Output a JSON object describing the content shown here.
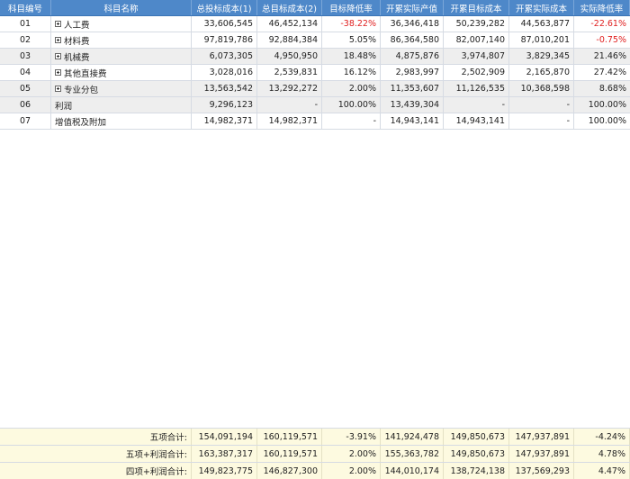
{
  "headers": [
    "科目编号",
    "科目名称",
    "总投标成本(1)",
    "总目标成本(2)",
    "目标降低率",
    "开累实际产值",
    "开累目标成本",
    "开累实际成本",
    "实际降低率"
  ],
  "rows": [
    {
      "code": "01",
      "name": "人工费",
      "expand": true,
      "v1": "33,606,545",
      "v2": "46,452,134",
      "r1": "-38.22%",
      "p": "36,346,418",
      "t": "50,239,282",
      "a": "44,563,877",
      "r2": "-22.61%",
      "r1neg": true,
      "r2neg": true,
      "alt": false
    },
    {
      "code": "02",
      "name": "材料费",
      "expand": true,
      "v1": "97,819,786",
      "v2": "92,884,384",
      "r1": "5.05%",
      "p": "86,364,580",
      "t": "82,007,140",
      "a": "87,010,201",
      "r2": "-0.75%",
      "r1neg": false,
      "r2neg": true,
      "alt": false
    },
    {
      "code": "03",
      "name": "机械费",
      "expand": true,
      "v1": "6,073,305",
      "v2": "4,950,950",
      "r1": "18.48%",
      "p": "4,875,876",
      "t": "3,974,807",
      "a": "3,829,345",
      "r2": "21.46%",
      "r1neg": false,
      "r2neg": false,
      "alt": true
    },
    {
      "code": "04",
      "name": "其他直接费",
      "expand": true,
      "v1": "3,028,016",
      "v2": "2,539,831",
      "r1": "16.12%",
      "p": "2,983,997",
      "t": "2,502,909",
      "a": "2,165,870",
      "r2": "27.42%",
      "r1neg": false,
      "r2neg": false,
      "alt": false
    },
    {
      "code": "05",
      "name": "专业分包",
      "expand": true,
      "v1": "13,563,542",
      "v2": "13,292,272",
      "r1": "2.00%",
      "p": "11,353,607",
      "t": "11,126,535",
      "a": "10,368,598",
      "r2": "8.68%",
      "r1neg": false,
      "r2neg": false,
      "alt": true
    },
    {
      "code": "06",
      "name": "利润",
      "expand": false,
      "v1": "9,296,123",
      "v2": "-",
      "r1": "100.00%",
      "p": "13,439,304",
      "t": "-",
      "a": "-",
      "r2": "100.00%",
      "r1neg": false,
      "r2neg": false,
      "alt": true
    },
    {
      "code": "07",
      "name": "增值税及附加",
      "expand": false,
      "v1": "14,982,371",
      "v2": "14,982,371",
      "r1": "-",
      "p": "14,943,141",
      "t": "14,943,141",
      "a": "-",
      "r2": "100.00%",
      "r1neg": false,
      "r2neg": false,
      "alt": false
    }
  ],
  "totals": [
    {
      "label": "五项合计:",
      "v1": "154,091,194",
      "v2": "160,119,571",
      "r1": "-3.91%",
      "p": "141,924,478",
      "t": "149,850,673",
      "a": "147,937,891",
      "r2": "-4.24%"
    },
    {
      "label": "五项+利润合计:",
      "v1": "163,387,317",
      "v2": "160,119,571",
      "r1": "2.00%",
      "p": "155,363,782",
      "t": "149,850,673",
      "a": "147,937,891",
      "r2": "4.78%"
    },
    {
      "label": "四项+利润合计:",
      "v1": "149,823,775",
      "v2": "146,827,300",
      "r1": "2.00%",
      "p": "144,010,174",
      "t": "138,724,138",
      "a": "137,569,293",
      "r2": "4.47%"
    }
  ]
}
